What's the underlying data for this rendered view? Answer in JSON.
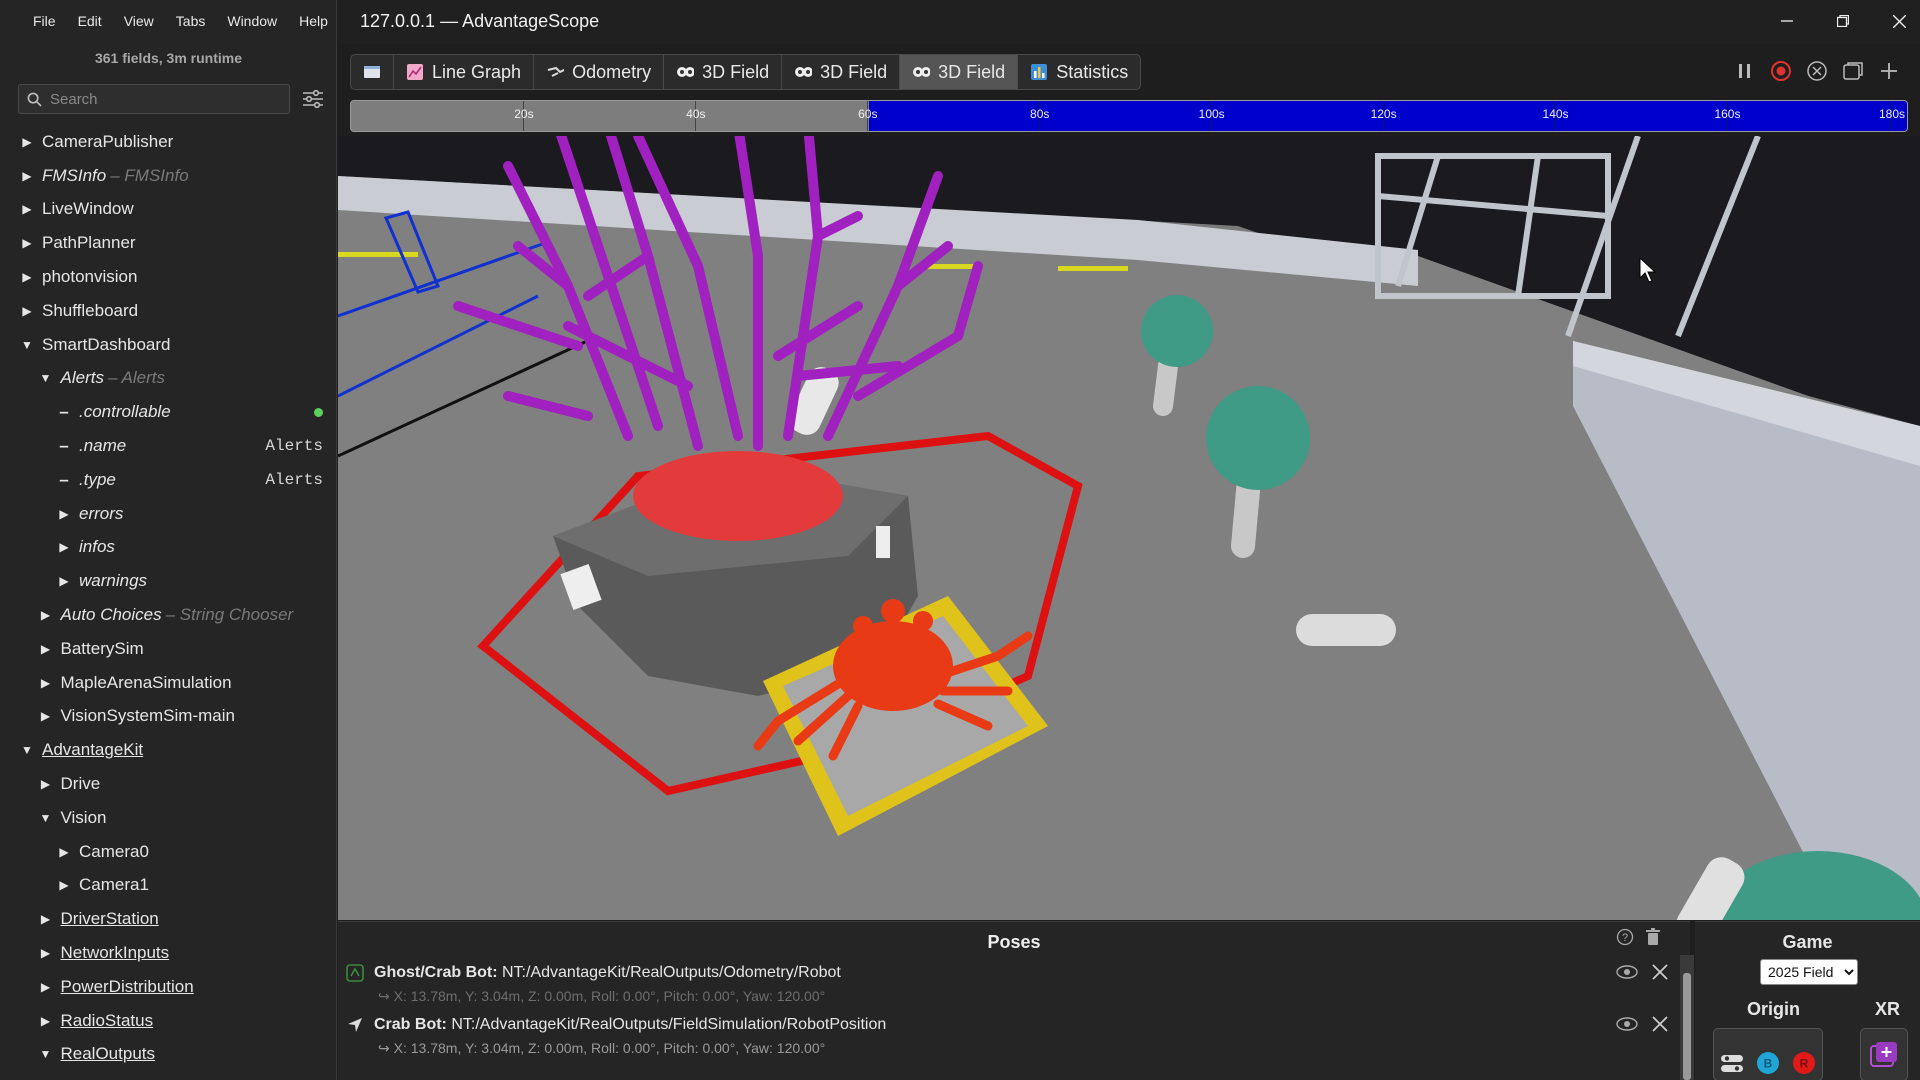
{
  "window": {
    "title": "127.0.0.1 — AdvantageScope"
  },
  "menu": [
    "File",
    "Edit",
    "View",
    "Tabs",
    "Window",
    "Help"
  ],
  "sidebar": {
    "fields_info": "361 fields, 3m runtime",
    "search_placeholder": "Search",
    "tree": [
      {
        "label": "CameraPublisher",
        "indent": 0,
        "toggle": "collapsed"
      },
      {
        "label": "FMSInfo",
        "suffix": "– FMSInfo",
        "indent": 0,
        "toggle": "collapsed",
        "italic": true
      },
      {
        "label": "LiveWindow",
        "indent": 0,
        "toggle": "collapsed"
      },
      {
        "label": "PathPlanner",
        "indent": 0,
        "toggle": "collapsed"
      },
      {
        "label": "photonvision",
        "indent": 0,
        "toggle": "collapsed"
      },
      {
        "label": "Shuffleboard",
        "indent": 0,
        "toggle": "collapsed"
      },
      {
        "label": "SmartDashboard",
        "indent": 0,
        "toggle": "expanded"
      },
      {
        "label": "Alerts",
        "suffix": "– Alerts",
        "indent": 1,
        "toggle": "expanded",
        "italic": true
      },
      {
        "label": ".controllable",
        "indent": 2,
        "toggle": "leaf",
        "italic": true,
        "indicator": "green-dot"
      },
      {
        "label": ".name",
        "indent": 2,
        "toggle": "leaf",
        "italic": true,
        "value": "Alerts"
      },
      {
        "label": ".type",
        "indent": 2,
        "toggle": "leaf",
        "italic": true,
        "value": "Alerts"
      },
      {
        "label": "errors",
        "indent": 2,
        "toggle": "collapsed",
        "italic": true
      },
      {
        "label": "infos",
        "indent": 2,
        "toggle": "collapsed",
        "italic": true
      },
      {
        "label": "warnings",
        "indent": 2,
        "toggle": "collapsed",
        "italic": true
      },
      {
        "label": "Auto Choices",
        "suffix": "– String Chooser",
        "indent": 1,
        "toggle": "collapsed",
        "italic": true
      },
      {
        "label": "BatterySim",
        "indent": 1,
        "toggle": "collapsed"
      },
      {
        "label": "MapleArenaSimulation",
        "indent": 1,
        "toggle": "collapsed"
      },
      {
        "label": "VisionSystemSim-main",
        "indent": 1,
        "toggle": "collapsed"
      },
      {
        "label": "AdvantageKit",
        "indent": 0,
        "toggle": "expanded",
        "underline": true
      },
      {
        "label": "Drive",
        "indent": 1,
        "toggle": "collapsed"
      },
      {
        "label": "Vision",
        "indent": 1,
        "toggle": "expanded"
      },
      {
        "label": "Camera0",
        "indent": 2,
        "toggle": "collapsed"
      },
      {
        "label": "Camera1",
        "indent": 2,
        "toggle": "collapsed"
      },
      {
        "label": "DriverStation",
        "indent": 1,
        "toggle": "collapsed",
        "underline": true
      },
      {
        "label": "NetworkInputs",
        "indent": 1,
        "toggle": "collapsed",
        "underline": true
      },
      {
        "label": "PowerDistribution",
        "indent": 1,
        "toggle": "collapsed",
        "underline": true
      },
      {
        "label": "RadioStatus",
        "indent": 1,
        "toggle": "collapsed",
        "underline": true
      },
      {
        "label": "RealOutputs",
        "indent": 1,
        "toggle": "expanded",
        "underline": true
      }
    ]
  },
  "tabs": [
    {
      "label": "",
      "icon": "document-icon",
      "active": false
    },
    {
      "label": "Line Graph",
      "icon": "line-graph-icon",
      "active": false
    },
    {
      "label": "Odometry",
      "icon": "odometry-icon",
      "active": false
    },
    {
      "label": "3D Field",
      "icon": "3d-field-icon",
      "active": false
    },
    {
      "label": "3D Field",
      "icon": "3d-field-icon",
      "active": false
    },
    {
      "label": "3D Field",
      "icon": "3d-field-icon",
      "active": true
    },
    {
      "label": "Statistics",
      "icon": "statistics-icon",
      "active": false
    }
  ],
  "controls": [
    "pause-icon",
    "record-icon",
    "close-circle-icon",
    "popout-icon",
    "add-icon"
  ],
  "timeline": {
    "ticks": [
      "20s",
      "40s",
      "60s",
      "80s",
      "100s",
      "120s",
      "140s",
      "160s",
      "180s"
    ],
    "tick_values": [
      20,
      40,
      60,
      80,
      100,
      120,
      140,
      160,
      180
    ],
    "range": [
      0,
      181
    ],
    "live_start": 60.3,
    "live_color": "#0000cc"
  },
  "poses": {
    "title": "Poses",
    "items": [
      {
        "name": "Ghost/Crab Bot:",
        "path": "NT:/AdvantageKit/RealOutputs/Odometry/Robot",
        "detail": "X: 13.78m, Y: 3.04m, Z: 0.00m, Roll: 0.00°, Pitch: 0.00°, Yaw: 120.00°",
        "icon": "ghost-icon"
      },
      {
        "name": "Crab Bot:",
        "path": "NT:/AdvantageKit/RealOutputs/FieldSimulation/RobotPosition",
        "detail": "X: 13.78m, Y: 3.04m, Z: 0.00m, Roll: 0.00°, Pitch: 0.00°, Yaw: 120.00°",
        "icon": "robot-arrow-icon"
      }
    ]
  },
  "settings": {
    "game_label": "Game",
    "game_value": "2025 Field",
    "origin_label": "Origin",
    "xr_label": "XR",
    "origin_options": [
      "Auto",
      "Blue",
      "Red"
    ]
  },
  "colors": {
    "accent_blue": "#0000cc",
    "alliance_blue": "#1fa5d6",
    "alliance_red": "#e01919",
    "algae": "#3f9a86",
    "coral_purple": "#a020c0"
  }
}
